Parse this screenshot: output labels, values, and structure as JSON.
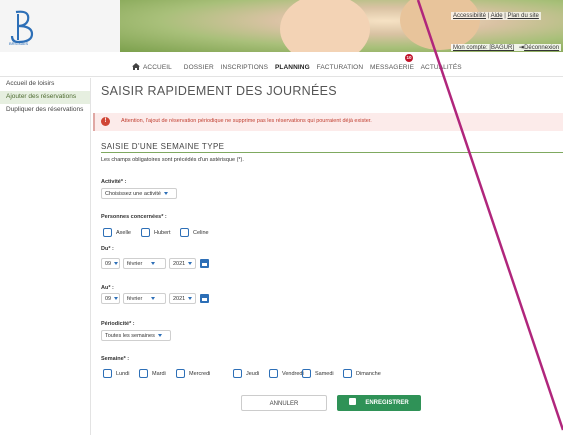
{
  "header": {
    "logo_text": "BRIGNAIS",
    "links": [
      "Accessibilité",
      "Aide",
      "Plan du site"
    ],
    "account": "Mon compte: [BAGUR]",
    "logout": "Déconnexion"
  },
  "nav": {
    "items": [
      "ACCUEIL",
      "DOSSIER",
      "INSCRIPTIONS",
      "PLANNING",
      "FACTURATION",
      "MESSAGERIE",
      "ACTUALITÉS"
    ],
    "active": "PLANNING",
    "badge": "10"
  },
  "sidebar": {
    "items": [
      "Accueil de loisirs",
      "Ajouter des réservations",
      "Dupliquer des réservations"
    ]
  },
  "main": {
    "title": "SAISIR RAPIDEMENT DES JOURNÉES",
    "alert": "Attention, l'ajout de réservation périodique ne supprime pas les réservations qui pourraient déjà exister.",
    "subtitle": "SAISIE D'UNE SEMAINE TYPE",
    "mandatory_note": "Les champs obligatoires sont précédés d'un astérisque (*).",
    "activite": {
      "label": "Activité",
      "value": "Choisissez une activité"
    },
    "personnes": {
      "label": "Personnes concernées",
      "options": [
        "Axelle",
        "Hubert",
        "Celine"
      ]
    },
    "du": {
      "label": "Du",
      "day": "09",
      "month": "février",
      "year": "2021"
    },
    "au": {
      "label": "Au",
      "day": "09",
      "month": "février",
      "year": "2021"
    },
    "periodicite": {
      "label": "Périodicité",
      "value": "Toutes les semaines"
    },
    "semaine": {
      "label": "Semaine",
      "days": [
        "Lundi",
        "Mardi",
        "Mercredi",
        "Jeudi",
        "Vendredi",
        "Samedi",
        "Dimanche"
      ]
    },
    "cancel_label": "ANNULER",
    "save_label": "ENREGISTRER"
  },
  "colors": {
    "accent": "#2f9257",
    "alert": "#c03d2f",
    "checkbox": "#2d6fb7",
    "annotation_line": "#b0267c"
  }
}
